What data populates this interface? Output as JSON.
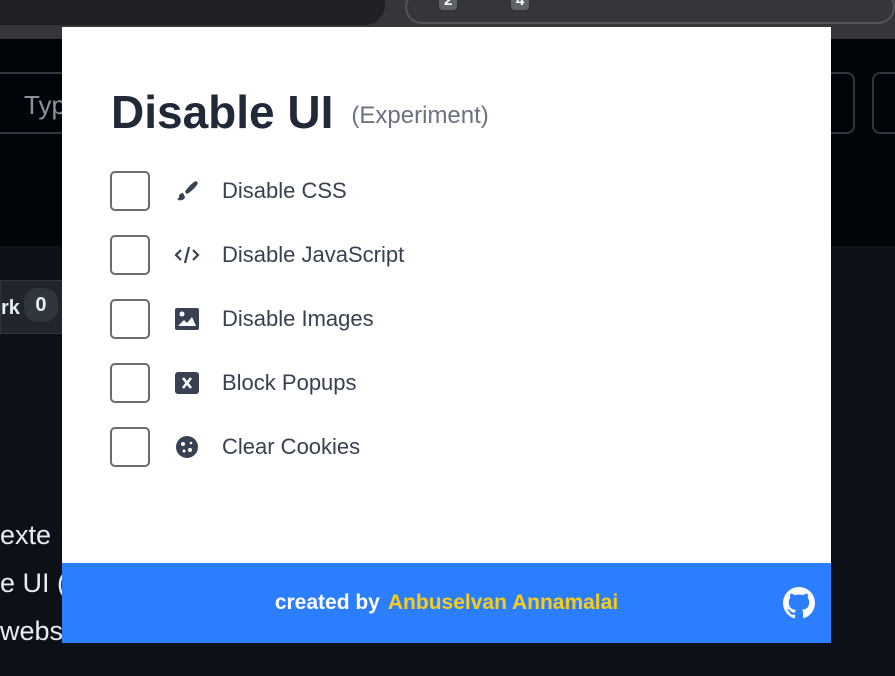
{
  "browser": {
    "badges": [
      "2",
      "4"
    ]
  },
  "background": {
    "search_text": "Typ",
    "fork_label": "rk",
    "fork_count": "0",
    "lines": [
      "exte",
      "e UI (",
      "websi"
    ]
  },
  "popup": {
    "title": "Disable UI",
    "subtitle": "(Experiment)",
    "options": [
      {
        "label": "Disable CSS",
        "icon": "paintbrush-icon",
        "checked": false
      },
      {
        "label": "Disable JavaScript",
        "icon": "code-icon",
        "checked": false
      },
      {
        "label": "Disable Images",
        "icon": "image-icon",
        "checked": false
      },
      {
        "label": "Block Popups",
        "icon": "close-square-icon",
        "checked": false
      },
      {
        "label": "Clear Cookies",
        "icon": "cookie-icon",
        "checked": false
      }
    ],
    "footer": {
      "prefix": "created by",
      "author": "Anbuselvan Annamalai",
      "icon": "github-icon"
    }
  },
  "colors": {
    "footer_bg": "#2b7fff",
    "author": "#facc15"
  }
}
